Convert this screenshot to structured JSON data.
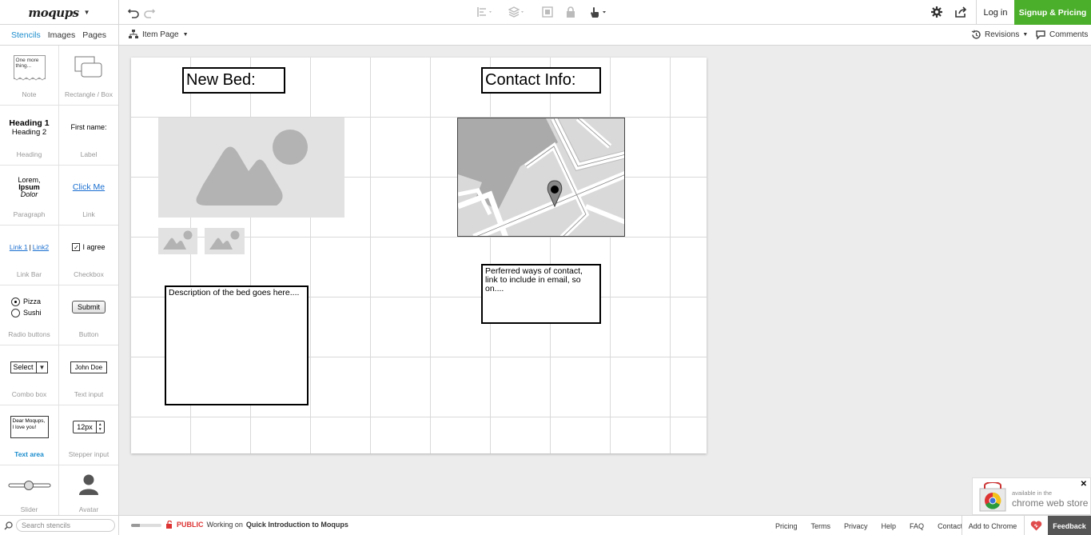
{
  "app": {
    "logo": "moqups",
    "login": "Log in",
    "signup": "Signup & Pricing"
  },
  "left_tabs": [
    "Stencils",
    "Images",
    "Pages"
  ],
  "page_selector": "Item Page",
  "revisions": "Revisions",
  "comments": "Comments",
  "stencils": [
    {
      "caption": "Note",
      "preview": "One more thing..."
    },
    {
      "caption": "Rectangle / Box"
    },
    {
      "caption": "Heading",
      "preview": [
        "Heading 1",
        "Heading 2"
      ]
    },
    {
      "caption": "Label",
      "preview": "First name:"
    },
    {
      "caption": "Paragraph",
      "preview": [
        "Lorem,",
        "Ipsum",
        "Dolor"
      ]
    },
    {
      "caption": "Link",
      "preview": "Click Me"
    },
    {
      "caption": "Link Bar",
      "preview": [
        "Link 1",
        "|",
        "Link2"
      ]
    },
    {
      "caption": "Checkbox",
      "preview": "I agree"
    },
    {
      "caption": "Radio buttons",
      "preview": [
        "Pizza",
        "Sushi"
      ]
    },
    {
      "caption": "Button",
      "preview": "Submit"
    },
    {
      "caption": "Combo box",
      "preview": "Select"
    },
    {
      "caption": "Text input",
      "preview": "John Doe"
    },
    {
      "caption": "Text area",
      "preview": "Dear Moqups, I love you!"
    },
    {
      "caption": "Stepper input",
      "preview": "12px"
    },
    {
      "caption": "Slider"
    },
    {
      "caption": "Avatar"
    }
  ],
  "canvas": {
    "new_bed_heading": "New Bed:",
    "contact_heading": "Contact Info:",
    "bed_description": "Description of the bed goes here....",
    "contact_text": "Perferred ways of contact, link to include in email, so on...."
  },
  "bottom": {
    "search_placeholder": "Search stencils",
    "public_label": "PUBLIC",
    "working_on": "Working on",
    "project": "Quick Introduction to Moqups",
    "progress_fraction": 0.3,
    "links": [
      "Pricing",
      "Terms",
      "Privacy",
      "Help",
      "FAQ",
      "Contact"
    ],
    "add_chrome": "Add to Chrome",
    "feedback": "Feedback"
  },
  "chrome_store": {
    "small": "available in the",
    "big": "chrome web store"
  }
}
